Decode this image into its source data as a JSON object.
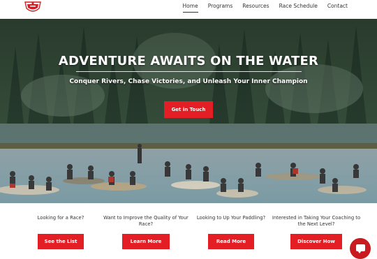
{
  "header": {
    "logo_icon": "canoe-club-crest-icon",
    "nav": [
      {
        "label": "Home",
        "active": true
      },
      {
        "label": "Programs",
        "active": false
      },
      {
        "label": "Resources",
        "active": false
      },
      {
        "label": "Race Schedule",
        "active": false
      },
      {
        "label": "Contact",
        "active": false
      }
    ]
  },
  "hero": {
    "title": "ADVENTURE AWAITS ON THE WATER",
    "subtitle": "Conquer Rivers, Chase Victories, and Unleash Your Inner Champion",
    "cta_label": "Get in Touch"
  },
  "cards": [
    {
      "question": "Looking for a Race?",
      "button": "See the List"
    },
    {
      "question": "Want to Improve the Quality of Your Race?",
      "button": "Learn More"
    },
    {
      "question": "Looking to Up Your Paddling?",
      "button": "Read More"
    },
    {
      "question": "Interested in Taking Your Coaching to the Next Level?",
      "button": "Discover How"
    }
  ],
  "chat": {
    "icon": "chat-bubble-icon"
  },
  "colors": {
    "accent": "#e31e24"
  }
}
